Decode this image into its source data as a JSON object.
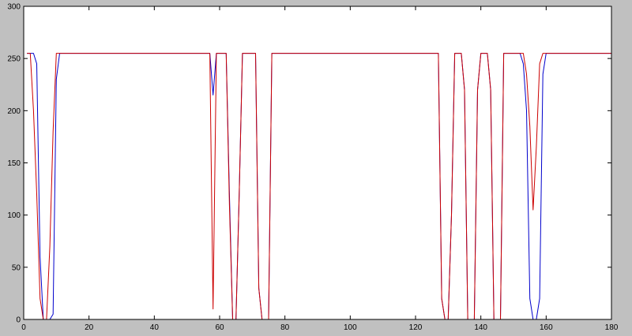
{
  "figure": {
    "background": "#c0c0c0",
    "axes_background": "#ffffff"
  },
  "chart_data": {
    "type": "line",
    "title": "",
    "xlabel": "",
    "ylabel": "",
    "xlim": [
      0,
      180
    ],
    "ylim": [
      0,
      300
    ],
    "x_ticks": [
      0,
      20,
      40,
      60,
      80,
      100,
      120,
      140,
      160,
      180
    ],
    "y_ticks": [
      0,
      50,
      100,
      150,
      200,
      250,
      300
    ],
    "grid": false,
    "legend": "none",
    "series": [
      {
        "color": "#0000cc",
        "x": [
          1,
          2,
          3,
          4,
          5,
          6,
          7,
          8,
          9,
          10,
          11,
          12,
          56,
          57,
          58,
          59,
          60,
          61,
          62,
          63,
          64,
          65,
          66,
          67,
          68,
          69,
          70,
          71,
          72,
          73,
          74,
          75,
          76,
          77,
          127,
          128,
          129,
          130,
          131,
          132,
          133,
          134,
          135,
          136,
          137,
          138,
          139,
          140,
          141,
          142,
          143,
          144,
          145,
          146,
          147,
          148,
          149,
          150,
          151,
          152,
          153,
          154,
          155,
          156,
          157,
          158,
          159,
          160,
          161,
          162,
          180
        ],
        "y": [
          255,
          255,
          255,
          245,
          60,
          0,
          0,
          0,
          5,
          230,
          255,
          255,
          255,
          255,
          215,
          255,
          255,
          255,
          255,
          120,
          0,
          0,
          120,
          255,
          255,
          255,
          255,
          255,
          30,
          0,
          0,
          0,
          255,
          255,
          255,
          20,
          0,
          0,
          100,
          255,
          255,
          255,
          220,
          0,
          0,
          0,
          220,
          255,
          255,
          255,
          220,
          0,
          0,
          0,
          255,
          255,
          255,
          255,
          255,
          255,
          245,
          200,
          20,
          0,
          0,
          20,
          235,
          255,
          255,
          255,
          255
        ]
      },
      {
        "color": "#cc0000",
        "x": [
          1,
          2,
          3,
          4,
          5,
          6,
          7,
          8,
          9,
          10,
          11,
          12,
          56,
          57,
          58,
          59,
          60,
          61,
          62,
          63,
          64,
          65,
          66,
          67,
          68,
          69,
          70,
          71,
          72,
          73,
          74,
          75,
          76,
          77,
          127,
          128,
          129,
          130,
          131,
          132,
          133,
          134,
          135,
          136,
          137,
          138,
          139,
          140,
          141,
          142,
          143,
          144,
          145,
          146,
          147,
          148,
          149,
          150,
          151,
          152,
          153,
          154,
          155,
          156,
          157,
          158,
          159,
          160,
          161,
          162,
          180
        ],
        "y": [
          255,
          255,
          200,
          120,
          20,
          0,
          0,
          70,
          180,
          255,
          255,
          255,
          255,
          255,
          10,
          255,
          255,
          255,
          255,
          110,
          0,
          0,
          120,
          255,
          255,
          255,
          255,
          255,
          30,
          0,
          0,
          0,
          255,
          255,
          255,
          20,
          0,
          0,
          100,
          255,
          255,
          255,
          220,
          0,
          0,
          0,
          220,
          255,
          255,
          255,
          220,
          0,
          0,
          0,
          255,
          255,
          255,
          255,
          255,
          255,
          255,
          235,
          185,
          105,
          165,
          245,
          255,
          255,
          255,
          255,
          255
        ]
      }
    ]
  }
}
